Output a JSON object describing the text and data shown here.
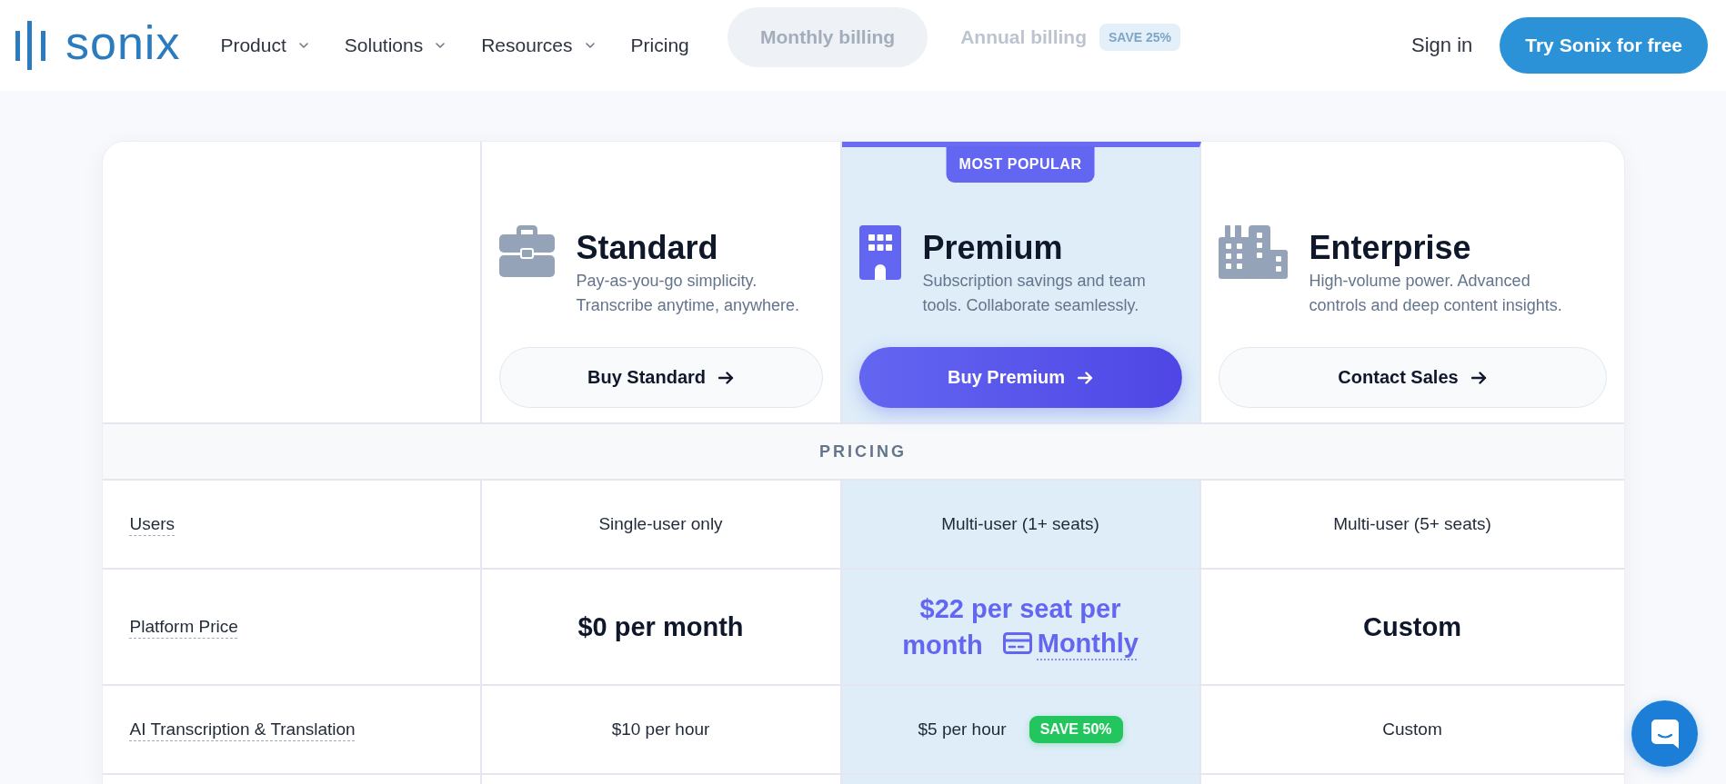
{
  "header": {
    "logo": "sonix",
    "nav": [
      {
        "label": "Product",
        "dropdown": true
      },
      {
        "label": "Solutions",
        "dropdown": true
      },
      {
        "label": "Resources",
        "dropdown": true
      },
      {
        "label": "Pricing",
        "dropdown": false
      }
    ],
    "billing_toggle": [
      {
        "label": "Monthly billing",
        "selected": true
      },
      {
        "label": "Annual billing",
        "selected": false,
        "badge": "SAVE 25%"
      }
    ],
    "sign_in": "Sign in",
    "cta": "Try Sonix for free"
  },
  "plans": [
    {
      "name": "Standard",
      "description": "Pay-as-you-go simplicity. Transcribe anytime, anywhere.",
      "button": "Buy Standard",
      "featured": false
    },
    {
      "name": "Premium",
      "description": "Subscription savings and team tools. Collaborate seamlessly.",
      "button": "Buy Premium",
      "featured": true,
      "badge": "MOST POPULAR"
    },
    {
      "name": "Enterprise",
      "description": "High-volume power. Advanced controls and deep content insights.",
      "button": "Contact Sales",
      "featured": false
    }
  ],
  "sections": [
    {
      "title": "PRICING",
      "rows": [
        {
          "label": "Users",
          "cells": [
            {
              "kind": "text",
              "text": "Single-user only"
            },
            {
              "kind": "text",
              "text": "Multi-user (1+ seats)"
            },
            {
              "kind": "text",
              "text": "Multi-user (5+ seats)"
            }
          ]
        },
        {
          "label": "Platform Price",
          "cells": [
            {
              "kind": "price",
              "text": "$0 per month"
            },
            {
              "kind": "price",
              "text": "$22 per seat per month",
              "billing": "Monthly"
            },
            {
              "kind": "price",
              "text": "Custom"
            }
          ]
        },
        {
          "label": "AI Transcription & Translation",
          "cells": [
            {
              "kind": "text",
              "text": "$10 per hour"
            },
            {
              "kind": "text",
              "text": "$5 per hour",
              "badge": "SAVE 50%"
            },
            {
              "kind": "text",
              "text": "Custom"
            }
          ]
        }
      ]
    }
  ]
}
